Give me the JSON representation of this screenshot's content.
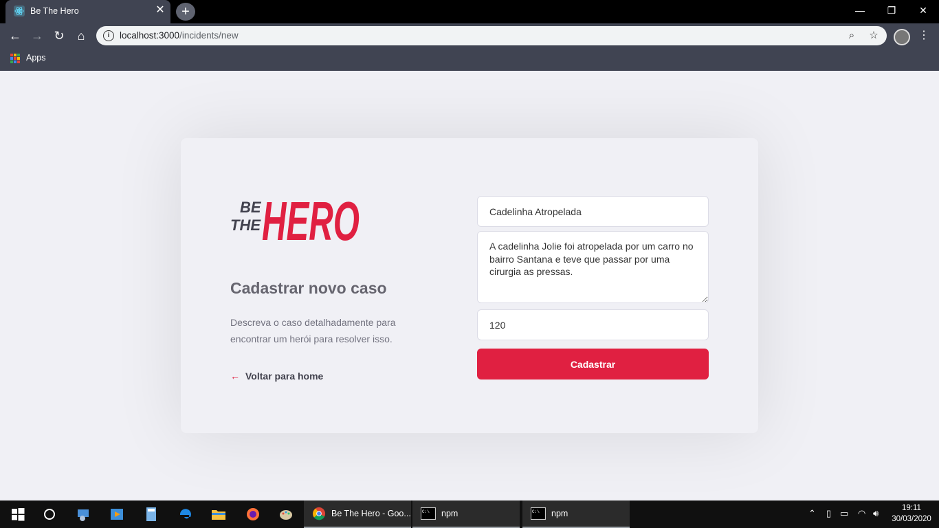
{
  "browser": {
    "tab_title": "Be The Hero",
    "url_host": "localhost:3000",
    "url_path": "/incidents/new",
    "bookmarks_apps_label": "Apps"
  },
  "page": {
    "logo_text": {
      "top": "BE",
      "middle": "THE",
      "big": "HERO"
    },
    "title": "Cadastrar novo caso",
    "description": "Descreva o caso detalhadamente para encontrar um herói para resolver isso.",
    "back_link": "Voltar para home",
    "form": {
      "title_value": "Cadelinha Atropelada",
      "description_value": "A cadelinha Jolie foi atropelada por um carro no bairro Santana e teve que passar por uma cirurgia as pressas.",
      "value_value": "120",
      "submit_label": "Cadastrar"
    }
  },
  "taskbar": {
    "apps": [
      {
        "label": "Be The Hero - Goo..."
      },
      {
        "label": "npm"
      },
      {
        "label": "npm"
      }
    ],
    "clock_time": "19:11",
    "clock_date": "30/03/2020"
  },
  "colors": {
    "accent": "#e02041",
    "background": "#f0f0f5",
    "chrome": "#404452"
  }
}
